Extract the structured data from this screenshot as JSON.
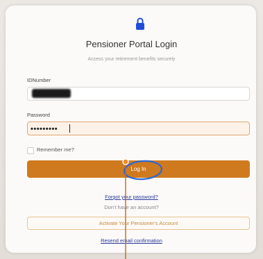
{
  "header": {
    "title": "Pensioner Portal Login",
    "subtitle": "Access your retirement benefits securely",
    "icon": "lock-icon",
    "accent_color": "#cf7a1f"
  },
  "form": {
    "id_label": "IDNumber",
    "id_value": "",
    "password_label": "Password",
    "password_value": "•••••••••",
    "remember_label": "Remember me?",
    "remember_checked": false,
    "login_button": "Log In"
  },
  "links": {
    "forgot_password": "Forgot your password?",
    "no_account": "Don't have an account?",
    "activate_account": "Activate Your Pensioner's Account",
    "resend_email": "Resend email confirmation"
  }
}
